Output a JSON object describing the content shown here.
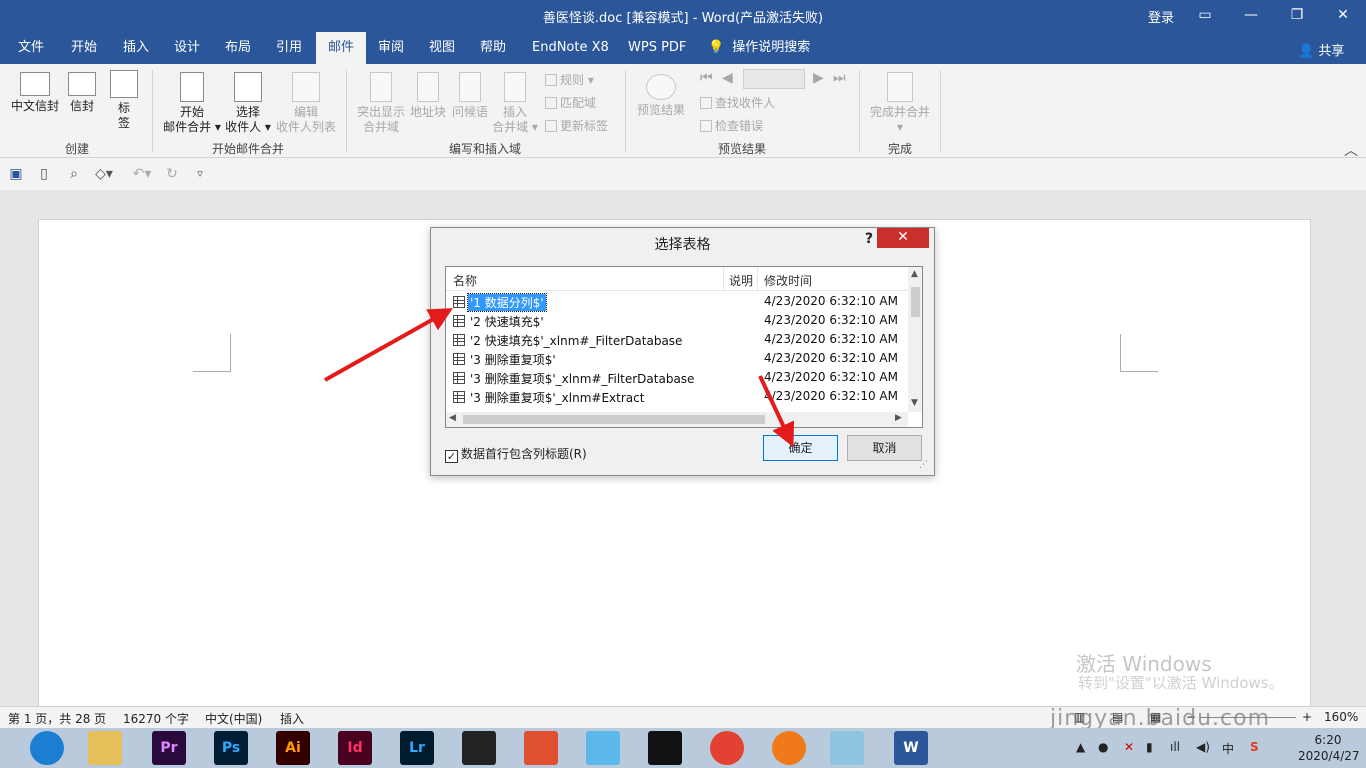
{
  "window": {
    "title": "善医怪谈.doc [兼容模式]  -  Word(产品激活失败)",
    "login": "登录",
    "min_glyph": "—",
    "restore_glyph": "❐",
    "close_glyph": "✕"
  },
  "tabs": [
    "文件",
    "开始",
    "插入",
    "设计",
    "布局",
    "引用",
    "邮件",
    "审阅",
    "视图",
    "帮助",
    "EndNote X8",
    "WPS PDF",
    "操作说明搜索"
  ],
  "share": "共享",
  "ribbon": {
    "create": {
      "envelope_cn": "中文信封",
      "envelope": "信封",
      "label_1": "标",
      "label_2": "签",
      "group": "创建"
    },
    "start": {
      "start_1": "开始",
      "start_2": "邮件合并",
      "select_1": "选择",
      "select_2": "收件人",
      "edit_1": "编辑",
      "edit_2": "收件人列表",
      "group": "开始邮件合并"
    },
    "write": {
      "highlight_1": "突出显示",
      "highlight_2": "合并域",
      "address": "地址块",
      "greeting": "问候语",
      "insert_1": "插入",
      "insert_2": "合并域",
      "rules": "规则",
      "match": "匹配域",
      "update": "更新标签",
      "group": "编写和插入域"
    },
    "preview": {
      "preview": "预览结果",
      "find": "查找收件人",
      "check": "检查错误",
      "group": "预览结果"
    },
    "finish": {
      "finish": "完成并合并",
      "group": "完成"
    }
  },
  "dialog": {
    "title": "选择表格",
    "help": "?",
    "close": "✕",
    "columns": [
      "名称",
      "说明",
      "修改时间"
    ],
    "rows": [
      {
        "name": "'1 数据分列$'",
        "time": "4/23/2020 6:32:10 AM",
        "selected": true
      },
      {
        "name": "'2 快速填充$'",
        "time": "4/23/2020 6:32:10 AM"
      },
      {
        "name": "'2 快速填充$'_xlnm#_FilterDatabase",
        "time": "4/23/2020 6:32:10 AM"
      },
      {
        "name": "'3 删除重复项$'",
        "time": "4/23/2020 6:32:10 AM"
      },
      {
        "name": "'3 删除重复项$'_xlnm#_FilterDatabase",
        "time": "4/23/2020 6:32:10 AM"
      },
      {
        "name": "'3 删除重复项$'_xlnm#Extract",
        "time": "4/23/2020 6:32:10 AM"
      }
    ],
    "checkbox_label": "数据首行包含列标题(R)",
    "checkbox_checked": true,
    "ok": "确定",
    "cancel": "取消"
  },
  "watermark": {
    "activate": "激活 Windows",
    "activate_sub": "转到\"设置\"以激活 Windows。",
    "site": "jingyan.baidu.com"
  },
  "status": {
    "page": "第 1 页，共 28 页",
    "words": "16270 个字",
    "lang": "中文(中国)",
    "mode": "插入",
    "zoom": "160%",
    "minus": "−",
    "plus": "+"
  },
  "taskbar": {
    "apps": [
      {
        "label": "",
        "color": "#1b7fd1"
      },
      {
        "label": "",
        "color": "#e8c05a"
      },
      {
        "label": "Pr",
        "color": "#2a0a3d",
        "fg": "#e088ff"
      },
      {
        "label": "Ps",
        "color": "#001d34",
        "fg": "#31a8ff"
      },
      {
        "label": "Ai",
        "color": "#330000",
        "fg": "#ff9a00"
      },
      {
        "label": "Id",
        "color": "#49021f",
        "fg": "#ff3366"
      },
      {
        "label": "Lr",
        "color": "#001a2e",
        "fg": "#31a8ff"
      },
      {
        "label": "",
        "color": "#222222"
      },
      {
        "label": "",
        "color": "#e05030"
      },
      {
        "label": "",
        "color": "#5bb8e8"
      },
      {
        "label": "",
        "color": "#111111"
      },
      {
        "label": "",
        "color": "#e34133"
      },
      {
        "label": "",
        "color": "#f07a1a"
      },
      {
        "label": "",
        "color": "#8ec4e0"
      },
      {
        "label": "W",
        "color": "#2b579a",
        "fg": "#ffffff"
      }
    ],
    "ime": "中",
    "time": "6:20",
    "date": "2020/4/27"
  }
}
